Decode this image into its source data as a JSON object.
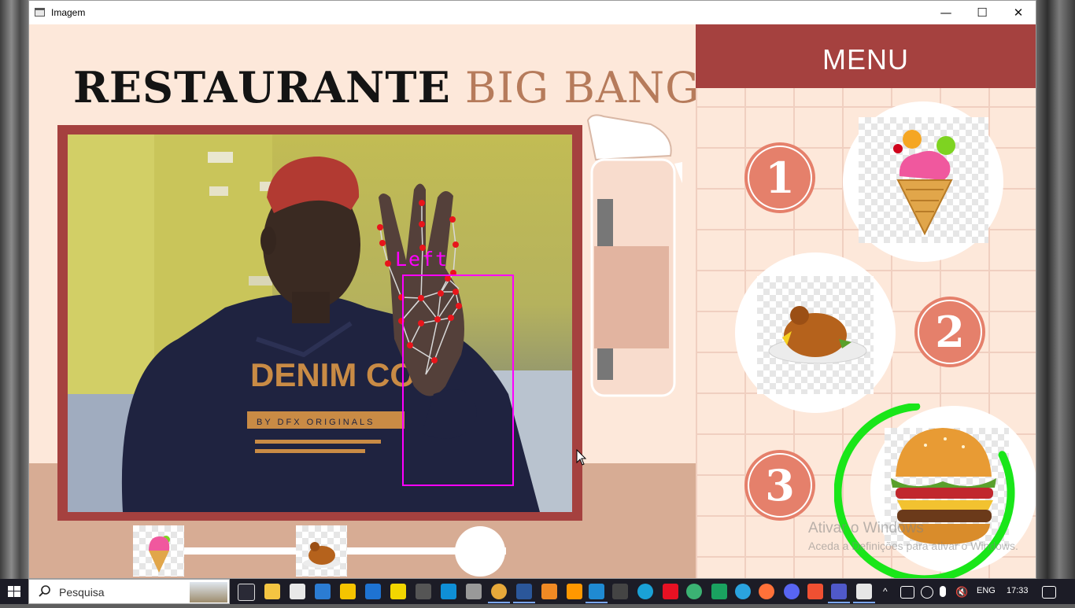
{
  "window": {
    "title": "Imagem",
    "minimize_glyph": "—",
    "maximize_glyph": "☐",
    "close_glyph": "✕"
  },
  "brand": {
    "part1": "RESTAURANTE",
    "part2": "BIG BANG",
    "accent_color": "#b67b5b",
    "frame_color": "#a5413f"
  },
  "camera": {
    "hand_label": "Left",
    "box_color": "#ff00ff",
    "landmark_color": "#e8151b",
    "shirt_text_main": "DENIM CO",
    "shirt_text_sub": "BY DFX ORIGINALS"
  },
  "menu": {
    "title": "MENU",
    "items": [
      {
        "number": "1",
        "food": "ice-cream",
        "selected": false
      },
      {
        "number": "2",
        "food": "roast-chicken",
        "selected": false
      },
      {
        "number": "3",
        "food": "burger",
        "selected": true
      }
    ],
    "selection_ring_color": "#19e619",
    "selection_progress": 0.85
  },
  "order": {
    "selected_items": [
      "ice-cream",
      "roast-chicken"
    ],
    "next_slot": "empty"
  },
  "watermark": {
    "line1": "Ativar o Windows",
    "line2": "Aceda a Definições para ativar o Windows."
  },
  "taskbar": {
    "search_placeholder": "Pesquisa",
    "language": "ENG",
    "time": "17:33",
    "apps": [
      "task-view",
      "file-explorer",
      "store",
      "mail",
      "drive",
      "outlook-cal",
      "media",
      "calculator",
      "snipping",
      "pen",
      "chrome",
      "word",
      "vlc",
      "sublime",
      "vscode",
      "terminal",
      "edge",
      "paint",
      "globe",
      "camtasia",
      "telegram",
      "firefox",
      "discord",
      "git",
      "teams",
      "notepad"
    ]
  }
}
